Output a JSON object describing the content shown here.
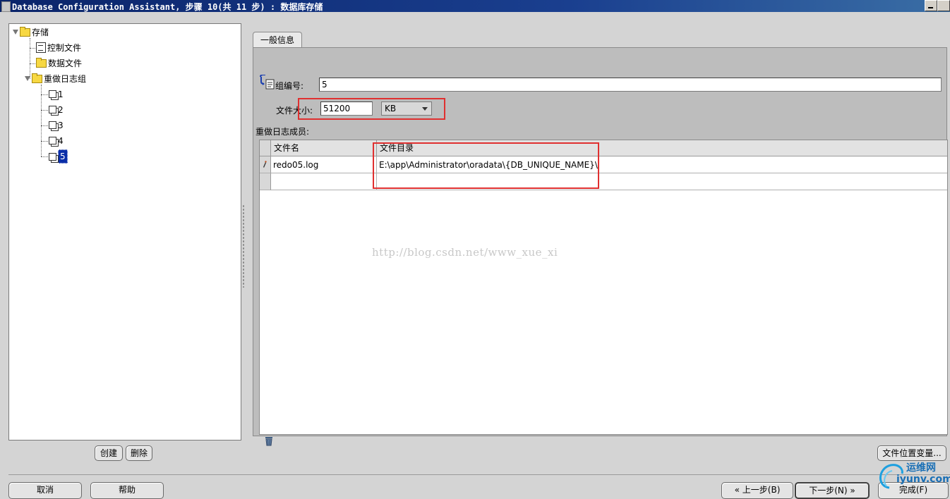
{
  "window": {
    "title": "Database Configuration Assistant, 步骤 10(共 11 步) : 数据库存储"
  },
  "tree": {
    "root": "存储",
    "control_files": "控制文件",
    "data_files": "数据文件",
    "redo_groups": "重做日志组",
    "groups": [
      "1",
      "2",
      "3",
      "4",
      "5"
    ],
    "selected_group": "5"
  },
  "left_buttons": {
    "create": "创建",
    "delete": "删除"
  },
  "tab": {
    "label": "一般信息"
  },
  "form": {
    "group_number_label": "组编号:",
    "group_number_value": "5",
    "file_size_label": "文件大小:",
    "file_size_value": "51200",
    "file_size_unit": "KB",
    "members_label": "重做日志成员:"
  },
  "table": {
    "columns": [
      "文件名",
      "文件目录"
    ],
    "rows": [
      {
        "file_name": "redo05.log",
        "directory": "E:\\app\\Administrator\\oradata\\{DB_UNIQUE_NAME}\\"
      },
      {
        "file_name": "",
        "directory": ""
      }
    ]
  },
  "watermark": "http://blog.csdn.net/www_xue_xi",
  "bottom": {
    "file_location_vars": "文件位置变量...",
    "cancel": "取消",
    "help": "帮助",
    "back": "上一步(B)",
    "next": "下一步(N)",
    "finish": "完成(F)"
  },
  "logo": {
    "text_cn": "运维网",
    "text_url": "iyunv.com"
  },
  "colors": {
    "highlight_red": "#e03030",
    "selection_blue": "#0a2ea8",
    "title_blue": "#0a246a"
  }
}
